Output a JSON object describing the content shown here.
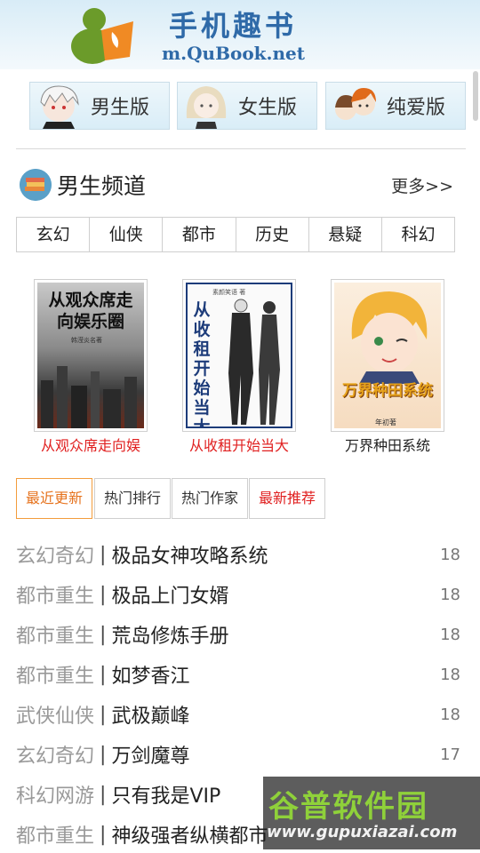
{
  "header": {
    "title": "手机趣书",
    "url": "m.QuBook.net",
    "logo_icon": "qubook-logo"
  },
  "versions": [
    {
      "label": "男生版",
      "icon": "boy-avatar"
    },
    {
      "label": "女生版",
      "icon": "girl-avatar"
    },
    {
      "label": "纯爱版",
      "icon": "couple-avatar"
    }
  ],
  "channel": {
    "title": "男生频道",
    "more": "更多>>",
    "icon": "books-icon"
  },
  "genres": [
    "玄幻",
    "仙侠",
    "都市",
    "历史",
    "悬疑",
    "科幻"
  ],
  "books": [
    {
      "name": "从观众席走向娱",
      "cover_text": "从观众席走向娱乐圈",
      "cover_author": "韩滢炎名著",
      "name_color": "#e02020"
    },
    {
      "name": "从收租开始当大",
      "cover_text": "从收租开始当大佬",
      "cover_author": "素颜笑语 著",
      "name_color": "#e02020"
    },
    {
      "name": "万界种田系统",
      "cover_text": "万界种田系统",
      "cover_author": "年初著",
      "name_color": "#222222"
    }
  ],
  "tabs": [
    {
      "label": "最近更新",
      "active": true
    },
    {
      "label": "热门排行",
      "active": false
    },
    {
      "label": "热门作家",
      "active": false
    },
    {
      "label": "最新推荐",
      "active": false
    }
  ],
  "updates": [
    {
      "category": "玄幻奇幻",
      "title": "极品女神攻略系统",
      "date": "18"
    },
    {
      "category": "都市重生",
      "title": "极品上门女婿",
      "date": "18"
    },
    {
      "category": "都市重生",
      "title": "荒岛修炼手册",
      "date": "18"
    },
    {
      "category": "都市重生",
      "title": "如梦香江",
      "date": "18"
    },
    {
      "category": "武侠仙侠",
      "title": "武极巅峰",
      "date": "18"
    },
    {
      "category": "玄幻奇幻",
      "title": "万剑魔尊",
      "date": "17"
    },
    {
      "category": "科幻网游",
      "title": "只有我是VIP",
      "date": ""
    },
    {
      "category": "都市重生",
      "title": "神级强者纵横都市",
      "date": ""
    }
  ],
  "separator": "|",
  "watermark": {
    "text": "谷普软件园",
    "url": "www.gupuxiazai.com"
  },
  "colors": {
    "accent_blue": "#2f6aa8",
    "active_tab": "#e6731e",
    "red": "#e02020",
    "watermark_green": "#8fd13a"
  }
}
